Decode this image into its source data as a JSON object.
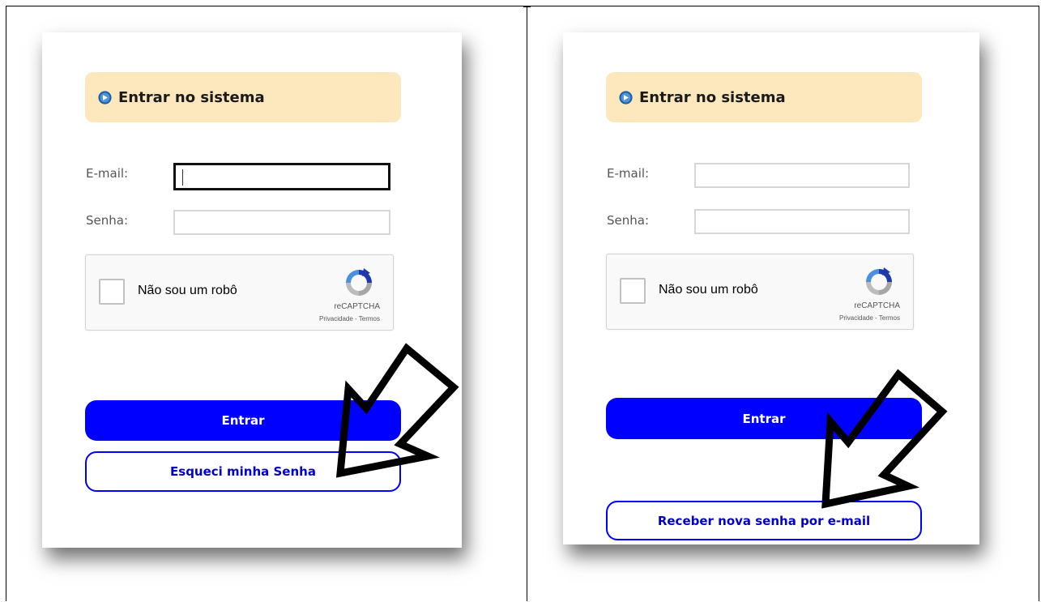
{
  "panels": [
    {
      "header_title": "Entrar no sistema",
      "email_label": "E-mail:",
      "email_value": "",
      "password_label": "Senha:",
      "password_value": "",
      "captcha_label": "Não sou um robô",
      "captcha_brand": "reCAPTCHA",
      "captcha_links": "Privacidade - Termos",
      "primary_button": "Entrar",
      "secondary_button": "Esqueci minha Senha"
    },
    {
      "header_title": "Entrar no sistema",
      "email_label": "E-mail:",
      "email_value": "",
      "password_label": "Senha:",
      "password_value": "",
      "captcha_label": "Não sou um robô",
      "captcha_brand": "reCAPTCHA",
      "captcha_links": "Privacidade - Termos",
      "primary_button": "Entrar",
      "secondary_button": "Receber nova senha por e-mail"
    }
  ],
  "colors": {
    "header_bg": "#fde7bd",
    "primary_button": "#0000ff",
    "outline_text": "#0000c8"
  },
  "icons": [
    "info-circle-icon",
    "recaptcha-logo-icon",
    "annotation-arrow"
  ]
}
